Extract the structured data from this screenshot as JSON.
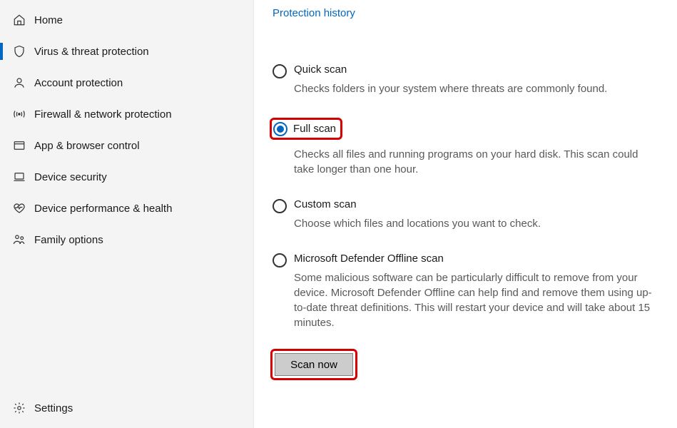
{
  "sidebar": {
    "items": [
      {
        "label": "Home"
      },
      {
        "label": "Virus & threat protection"
      },
      {
        "label": "Account protection"
      },
      {
        "label": "Firewall & network protection"
      },
      {
        "label": "App & browser control"
      },
      {
        "label": "Device security"
      },
      {
        "label": "Device performance & health"
      },
      {
        "label": "Family options"
      }
    ],
    "settings_label": "Settings"
  },
  "main": {
    "protection_history_link": "Protection history",
    "options": {
      "quick": {
        "title": "Quick scan",
        "desc": "Checks folders in your system where threats are commonly found."
      },
      "full": {
        "title": "Full scan",
        "desc": "Checks all files and running programs on your hard disk. This scan could take longer than one hour."
      },
      "custom": {
        "title": "Custom scan",
        "desc": "Choose which files and locations you want to check."
      },
      "offline": {
        "title": "Microsoft Defender Offline scan",
        "desc": "Some malicious software can be particularly difficult to remove from your device. Microsoft Defender Offline can help find and remove them using up-to-date threat definitions. This will restart your device and will take about 15 minutes."
      }
    },
    "scan_button": "Scan now"
  }
}
